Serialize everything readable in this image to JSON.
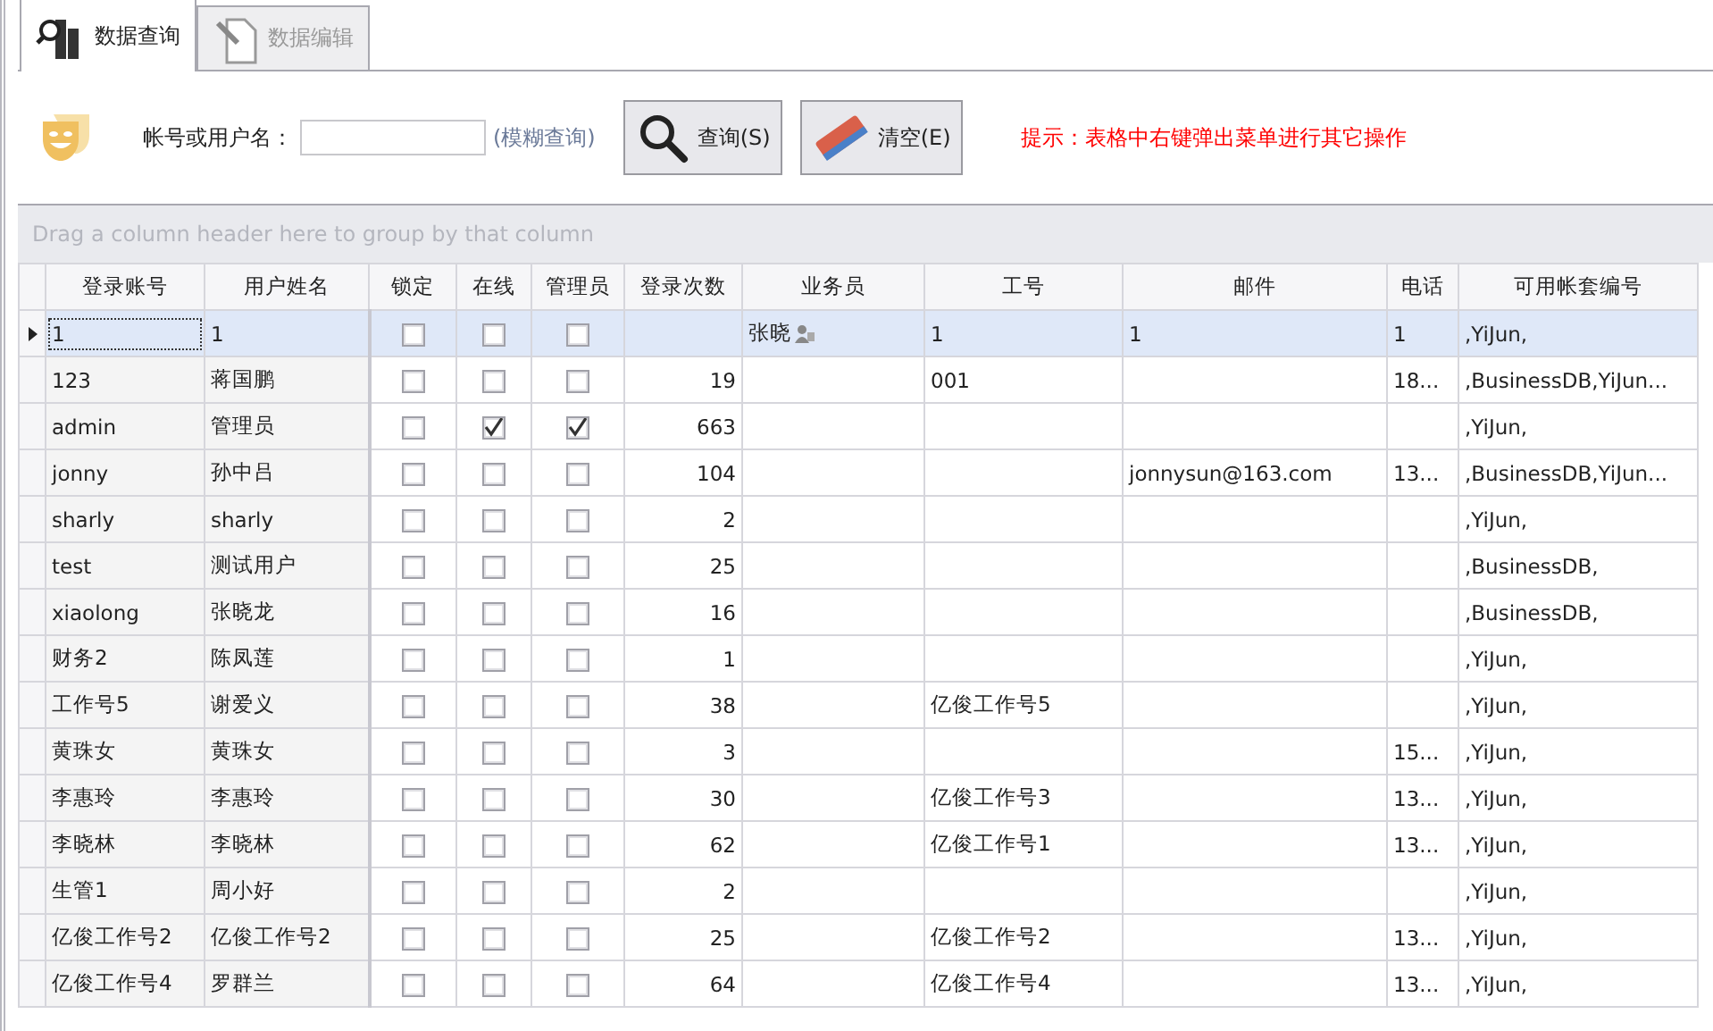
{
  "tabs": [
    {
      "label": "数据查询",
      "selected": true
    },
    {
      "label": "数据编辑",
      "selected": false
    }
  ],
  "search": {
    "label": "帐号或用户名：",
    "hint": "(模糊查询)"
  },
  "buttons": [
    {
      "kind": "search",
      "label": "查询(S)"
    },
    {
      "kind": "clear",
      "label": "清空(E)"
    }
  ],
  "tip": "提示：表格中右键弹出菜单进行其它操作",
  "group_panel": "Drag a column header here to group by that column",
  "table": {
    "columns": [
      "登录账号",
      "用户姓名",
      "锁定",
      "在线",
      "管理员",
      "登录次数",
      "业务员",
      "工号",
      "邮件",
      "电话",
      "可用帐套编号"
    ],
    "rows": [
      {
        "selected": true,
        "account": "1",
        "name": "1",
        "locked": false,
        "online": false,
        "admin": false,
        "logins": "",
        "salesperson": "张晓",
        "job_no": "1",
        "email": "1",
        "phone": "1",
        "books": ",YiJun,"
      },
      {
        "selected": false,
        "account": "123",
        "name": "蒋国鹏",
        "locked": false,
        "online": false,
        "admin": false,
        "logins": "19",
        "salesperson": "",
        "job_no": "001",
        "email": "",
        "phone": "18...",
        "books": ",BusinessDB,YiJun..."
      },
      {
        "selected": false,
        "account": "admin",
        "name": "管理员",
        "locked": false,
        "online": true,
        "admin": true,
        "logins": "663",
        "salesperson": "",
        "job_no": "",
        "email": "",
        "phone": "",
        "books": ",YiJun,"
      },
      {
        "selected": false,
        "account": "jonny",
        "name": "孙中吕",
        "locked": false,
        "online": false,
        "admin": false,
        "logins": "104",
        "salesperson": "",
        "job_no": "",
        "email": "jonnysun@163.com",
        "phone": "13...",
        "books": ",BusinessDB,YiJun..."
      },
      {
        "selected": false,
        "account": "sharly",
        "name": "sharly",
        "locked": false,
        "online": false,
        "admin": false,
        "logins": "2",
        "salesperson": "",
        "job_no": "",
        "email": "",
        "phone": "",
        "books": ",YiJun,"
      },
      {
        "selected": false,
        "account": "test",
        "name": "测试用户",
        "locked": false,
        "online": false,
        "admin": false,
        "logins": "25",
        "salesperson": "",
        "job_no": "",
        "email": "",
        "phone": "",
        "books": ",BusinessDB,"
      },
      {
        "selected": false,
        "account": "xiaolong",
        "name": "张晓龙",
        "locked": false,
        "online": false,
        "admin": false,
        "logins": "16",
        "salesperson": "",
        "job_no": "",
        "email": "",
        "phone": "",
        "books": ",BusinessDB,"
      },
      {
        "selected": false,
        "account": "财务2",
        "name": "陈凤莲",
        "locked": false,
        "online": false,
        "admin": false,
        "logins": "1",
        "salesperson": "",
        "job_no": "",
        "email": "",
        "phone": "",
        "books": ",YiJun,"
      },
      {
        "selected": false,
        "account": "工作号5",
        "name": "谢爱义",
        "locked": false,
        "online": false,
        "admin": false,
        "logins": "38",
        "salesperson": "",
        "job_no": "亿俊工作号5",
        "email": "",
        "phone": "",
        "books": ",YiJun,"
      },
      {
        "selected": false,
        "account": "黄珠女",
        "name": "黄珠女",
        "locked": false,
        "online": false,
        "admin": false,
        "logins": "3",
        "salesperson": "",
        "job_no": "",
        "email": "",
        "phone": "15...",
        "books": ",YiJun,"
      },
      {
        "selected": false,
        "account": "李惠玲",
        "name": "李惠玲",
        "locked": false,
        "online": false,
        "admin": false,
        "logins": "30",
        "salesperson": "",
        "job_no": "亿俊工作号3",
        "email": "",
        "phone": "13...",
        "books": ",YiJun,"
      },
      {
        "selected": false,
        "account": "李晓林",
        "name": "李晓林",
        "locked": false,
        "online": false,
        "admin": false,
        "logins": "62",
        "salesperson": "",
        "job_no": "亿俊工作号1",
        "email": "",
        "phone": "13...",
        "books": ",YiJun,"
      },
      {
        "selected": false,
        "account": "生管1",
        "name": "周小好",
        "locked": false,
        "online": false,
        "admin": false,
        "logins": "2",
        "salesperson": "",
        "job_no": "",
        "email": "",
        "phone": "",
        "books": ",YiJun,"
      },
      {
        "selected": false,
        "account": "亿俊工作号2",
        "name": "亿俊工作号2",
        "locked": false,
        "online": false,
        "admin": false,
        "logins": "25",
        "salesperson": "",
        "job_no": "亿俊工作号2",
        "email": "",
        "phone": "13...",
        "books": ",YiJun,"
      },
      {
        "selected": false,
        "account": "亿俊工作号4",
        "name": "罗群兰",
        "locked": false,
        "online": false,
        "admin": false,
        "logins": "64",
        "salesperson": "",
        "job_no": "亿俊工作号4",
        "email": "",
        "phone": "13...",
        "books": ",YiJun,"
      }
    ]
  }
}
